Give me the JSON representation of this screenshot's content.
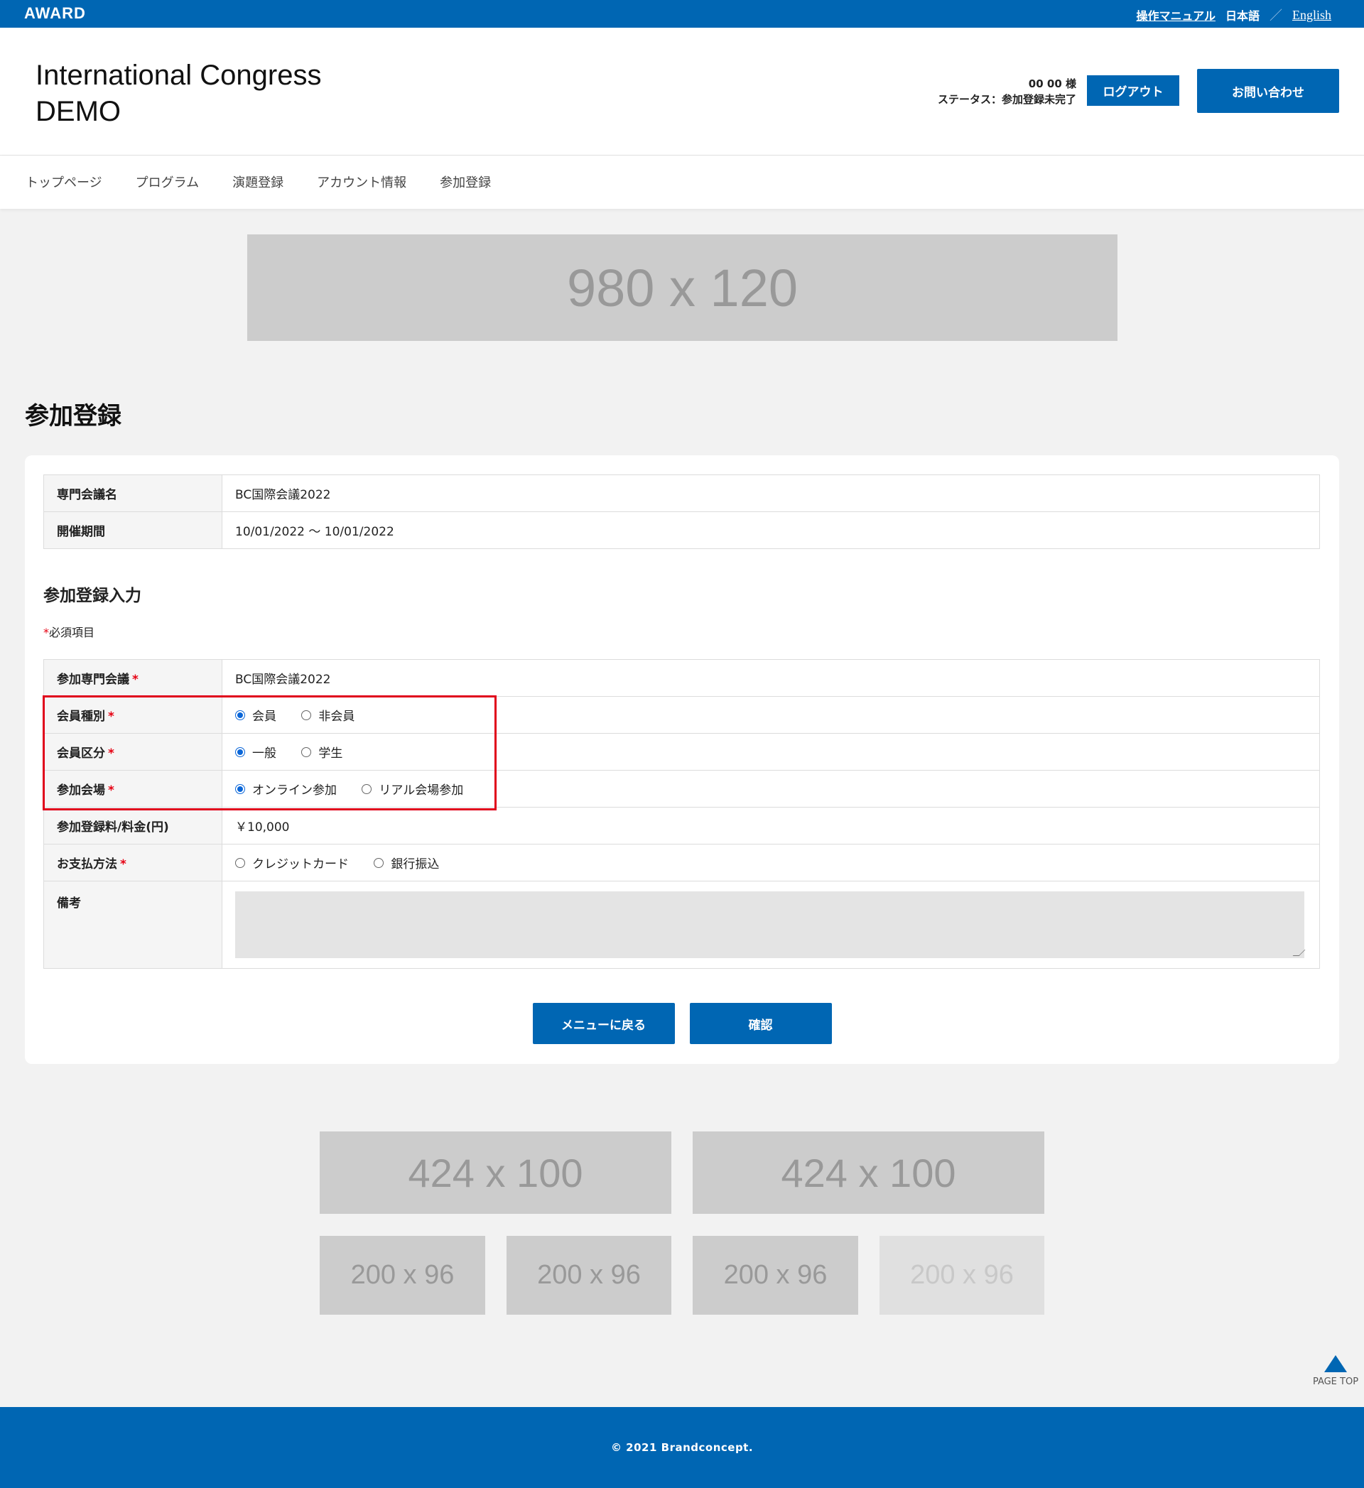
{
  "topbar": {
    "logo": "AWARD",
    "manual_link": "操作マニュアル",
    "lang_ja": "日本語",
    "lang_sep": "／",
    "lang_en": "English"
  },
  "header": {
    "title_line1": "International Congress",
    "title_line2": "DEMO",
    "user_name": "00 00 様",
    "status": "ステータス：参加登録未完了",
    "logout_label": "ログアウト",
    "contact_label": "お問い合わせ"
  },
  "nav": {
    "items": [
      "トップページ",
      "プログラム",
      "演題登録",
      "アカウント情報",
      "参加登録"
    ]
  },
  "banners": {
    "top": "980 x 120",
    "mid_left": "424 x 100",
    "mid_right": "424 x 100",
    "small_1": "200 x 96",
    "small_2": "200 x 96",
    "small_3": "200 x 96",
    "small_4": "200 x 96"
  },
  "page_title": "参加登録",
  "info": {
    "rows": [
      {
        "label": "専門会議名",
        "value": "BC国際会議2022"
      },
      {
        "label": "開催期間",
        "value": "10/01/2022 ～ 10/01/2022"
      }
    ]
  },
  "form": {
    "title": "参加登録入力",
    "required_mark": "*",
    "required_note": "必須項目",
    "conference": {
      "label": "参加専門会議",
      "value": "BC国際会議2022"
    },
    "member_type": {
      "label": "会員種別",
      "options": [
        "会員",
        "非会員"
      ],
      "selected": "会員"
    },
    "member_class": {
      "label": "会員区分",
      "options": [
        "一般",
        "学生"
      ],
      "selected": "一般"
    },
    "venue": {
      "label": "参加会場",
      "options": [
        "オンライン参加",
        "リアル会場参加"
      ],
      "selected": "オンライン参加"
    },
    "fee": {
      "label": "参加登録料/料金(円)",
      "value": "￥10,000"
    },
    "payment": {
      "label": "お支払方法",
      "options": [
        "クレジットカード",
        "銀行振込"
      ],
      "selected": ""
    },
    "remarks": {
      "label": "備考",
      "value": ""
    },
    "back_label": "メニューに戻る",
    "confirm_label": "確認"
  },
  "page_top_label": "PAGE TOP",
  "footer": {
    "copyright": "© 2021 Brandconcept."
  },
  "colors": {
    "brand": "#0066b3",
    "required": "#e60012",
    "highlight": "#e0001b"
  }
}
